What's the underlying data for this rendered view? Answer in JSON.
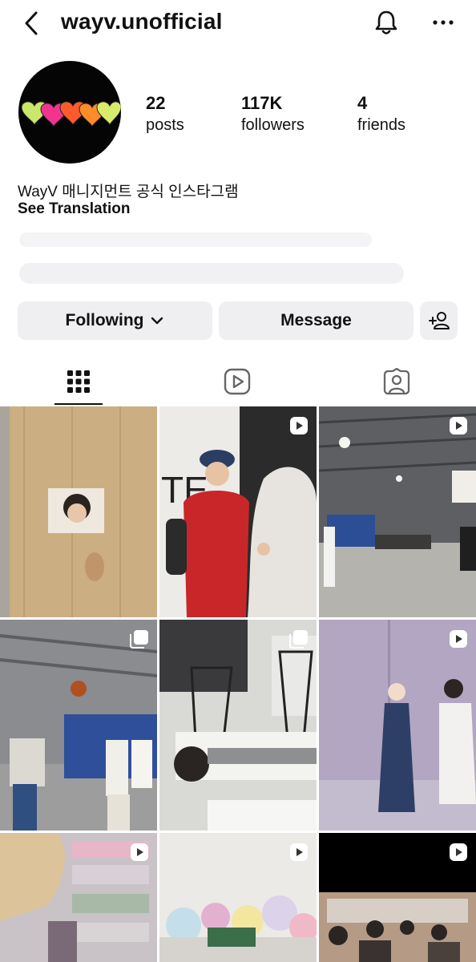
{
  "header": {
    "username": "wayv.unofficial"
  },
  "profile": {
    "stats": [
      {
        "value": "22",
        "label": "posts"
      },
      {
        "value": "117K",
        "label": "followers"
      },
      {
        "value": "4",
        "label": "friends"
      }
    ],
    "bio": "WayV 매니지먼트 공식 인스타그램",
    "see_translation": "See Translation"
  },
  "actions": {
    "following_label": "Following",
    "message_label": "Message"
  },
  "tabs": [
    "grid",
    "reels",
    "tagged"
  ],
  "posts": [
    {
      "type": "photo"
    },
    {
      "type": "reel"
    },
    {
      "type": "reel"
    },
    {
      "type": "carousel"
    },
    {
      "type": "carousel"
    },
    {
      "type": "reel"
    },
    {
      "type": "reel"
    },
    {
      "type": "reel"
    },
    {
      "type": "reel"
    }
  ]
}
